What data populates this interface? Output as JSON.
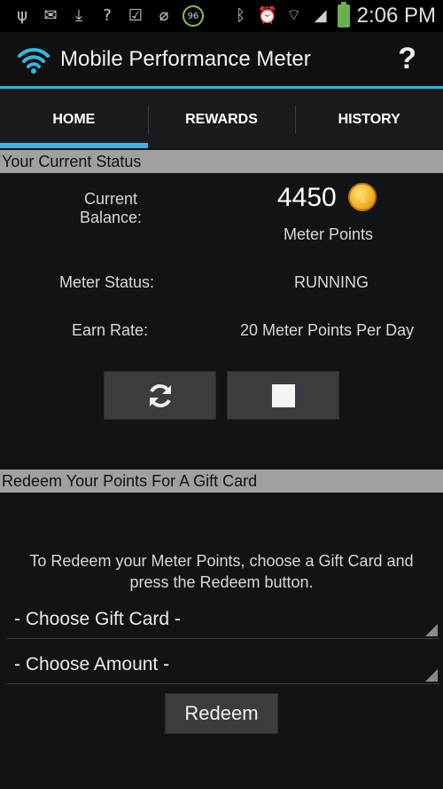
{
  "status_bar": {
    "time": "2:06 PM",
    "badge": "96",
    "icons": [
      "usb-icon",
      "gmail-icon",
      "download-icon",
      "unknown-icon",
      "checkbox-icon",
      "voicemail-icon",
      "badge-96-icon",
      "bluetooth-icon",
      "alarm-icon",
      "wifi-icon",
      "signal-icon",
      "battery-charging-icon"
    ],
    "question_glyph": "?"
  },
  "app_bar": {
    "title": "Mobile Performance Meter",
    "help_label": "?"
  },
  "tabs": [
    {
      "label": "HOME",
      "active": true
    },
    {
      "label": "REWARDS",
      "active": false
    },
    {
      "label": "HISTORY",
      "active": false
    }
  ],
  "current_status": {
    "header": "Your Current Status",
    "balance_label_line1": "Current",
    "balance_label_line2": "Balance:",
    "balance_value": "4450",
    "balance_unit": "Meter Points",
    "meter_status_label": "Meter Status:",
    "meter_status_value": "RUNNING",
    "earn_rate_label": "Earn Rate:",
    "earn_rate_value": "20 Meter Points Per Day"
  },
  "redeem": {
    "header": "Redeem Your Points For A Gift Card",
    "instructions_line1": "To Redeem your Meter Points, choose a Gift Card and",
    "instructions_line2": "press the Redeem button.",
    "gift_card_select": "- Choose Gift Card -",
    "amount_select": "- Choose Amount -",
    "redeem_button": "Redeem"
  },
  "colors": {
    "accent": "#39b5e0",
    "section_header_bg": "#a0a0a0",
    "coin": "#f0b020"
  }
}
